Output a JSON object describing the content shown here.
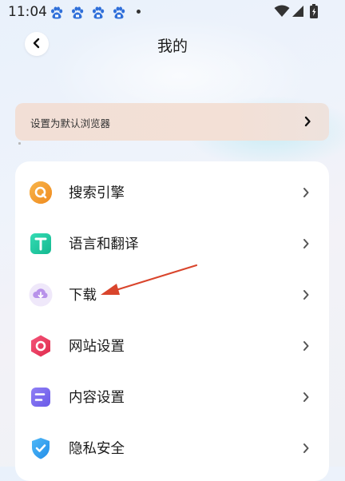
{
  "status_bar": {
    "time": "11:04",
    "notification_icons": [
      "baidu-paw-icon",
      "baidu-paw-icon",
      "baidu-paw-icon",
      "baidu-paw-icon"
    ]
  },
  "header": {
    "title": "我的",
    "back_icon": "chevron-left-icon"
  },
  "banner": {
    "label": "设置为默认浏览器",
    "icon": "chevron-right-icon"
  },
  "menu": {
    "items": [
      {
        "label": "搜索引擎",
        "icon": "search-engine-icon",
        "color": "#f39a26"
      },
      {
        "label": "语言和翻译",
        "icon": "translate-icon",
        "color": "#22c9a4"
      },
      {
        "label": "下载",
        "icon": "download-cloud-icon",
        "color": "#b38ae6"
      },
      {
        "label": "网站设置",
        "icon": "website-settings-icon",
        "color": "#ea3a5e"
      },
      {
        "label": "内容设置",
        "icon": "content-settings-icon",
        "color": "#7b6ef0"
      },
      {
        "label": "隐私安全",
        "icon": "privacy-shield-icon",
        "color": "#36a0f0"
      }
    ]
  },
  "annotation": {
    "type": "arrow",
    "color": "#d9452c",
    "points_to": "下载"
  }
}
